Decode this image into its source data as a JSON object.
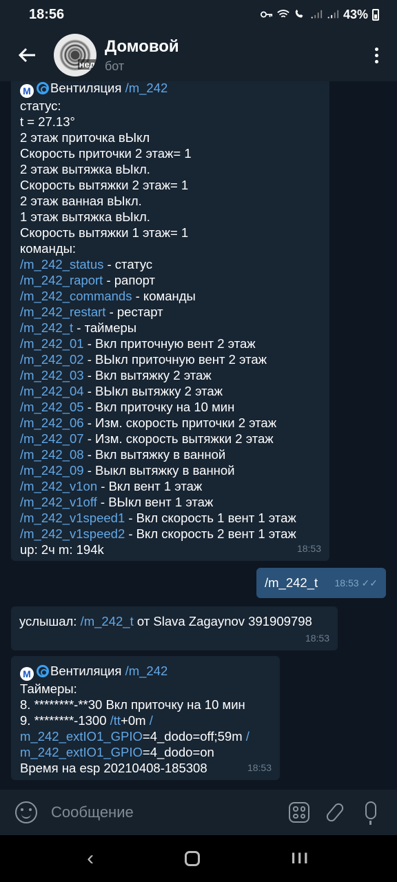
{
  "status_bar": {
    "time": "18:56",
    "battery": "43%"
  },
  "header": {
    "back_icon": "arrow-left-icon",
    "avatar_badge": "нед",
    "title": "Домовой",
    "subtitle": "бот",
    "menu_icon": "more-vertical-icon"
  },
  "messages": {
    "m1": {
      "head_mark": "M",
      "head_text": "Вентиляция ",
      "head_link": "/m_242",
      "lines": [
        "статус:",
        "t = 27.13°",
        "2 этаж приточка вЫкл",
        "Скорость приточки 2 этаж= 1",
        "2 этаж вытяжка вЫкл.",
        "Скорость вытяжки 2 этаж= 1",
        "2 этаж ванная вЫкл.",
        "1 этаж вытяжка вЫкл.",
        "Скорость вытяжки 1 этаж= 1",
        "команды:"
      ],
      "commands": [
        {
          "link": "/m_242_status",
          "text": " - статус"
        },
        {
          "link": "/m_242_raport",
          "text": " - рапорт"
        },
        {
          "link": "/m_242_commands",
          "text": " - команды"
        },
        {
          "link": "/m_242_restart",
          "text": " - рестарт"
        },
        {
          "link": "/m_242_t",
          "text": " - таймеры"
        },
        {
          "link": "/m_242_01",
          "text": " - Вкл приточную вент 2 этаж"
        },
        {
          "link": "/m_242_02",
          "text": " - ВЫкл приточную вент 2 этаж"
        },
        {
          "link": "/m_242_03",
          "text": " - Вкл вытяжку 2 этаж"
        },
        {
          "link": "/m_242_04",
          "text": " - ВЫкл вытяжку 2 этаж"
        },
        {
          "link": "/m_242_05",
          "text": " - Вкл приточку на 10 мин"
        },
        {
          "link": "/m_242_06",
          "text": " - Изм. скорость приточки 2 этаж"
        },
        {
          "link": "/m_242_07",
          "text": " - Изм. скорость вытяжки 2 этаж"
        },
        {
          "link": "/m_242_08",
          "text": " - Вкл вытяжку в ванной"
        },
        {
          "link": "/m_242_09",
          "text": " - Выкл вытяжку в ванной"
        },
        {
          "link": "/m_242_v1on",
          "text": " - Вкл вент 1 этаж"
        },
        {
          "link": "/m_242_v1off",
          "text": " - ВЫкл вент 1 этаж"
        },
        {
          "link": "/m_242_v1speed1",
          "text": " - Вкл скорость 1 вент 1 этаж"
        },
        {
          "link": "/m_242_v1speed2",
          "text": " - Вкл скорость 2 вент 1 этаж"
        }
      ],
      "footer": "up: 2ч m: 194k",
      "time": "18:53"
    },
    "m2": {
      "link": "/m_242_t",
      "time": "18:53"
    },
    "m3": {
      "prefix": "услышал: ",
      "link": "/m_242_t",
      "suffix": " от Slava Zagaynov 391909798",
      "time": "18:53"
    },
    "m4": {
      "head_mark": "M",
      "head_text": "Вентиляция ",
      "head_link": "/m_242",
      "l1": "Таймеры:",
      "l2": "8. ********-**30 Вкл приточку на 10 мин",
      "l3a": "9. ********-1300 ",
      "l3b": "/tt",
      "l3c": "+0m ",
      "l3d": "/",
      "l4a": "m_242_extIO1_GPIO",
      "l4b": "=4_dodo=off;59m ",
      "l4c": "/",
      "l5a": "m_242_extIO1_GPIO",
      "l5b": "=4_dodo=on",
      "l6": "Время на esp 20210408-185308",
      "time": "18:53"
    }
  },
  "input": {
    "placeholder": "Сообщение"
  }
}
